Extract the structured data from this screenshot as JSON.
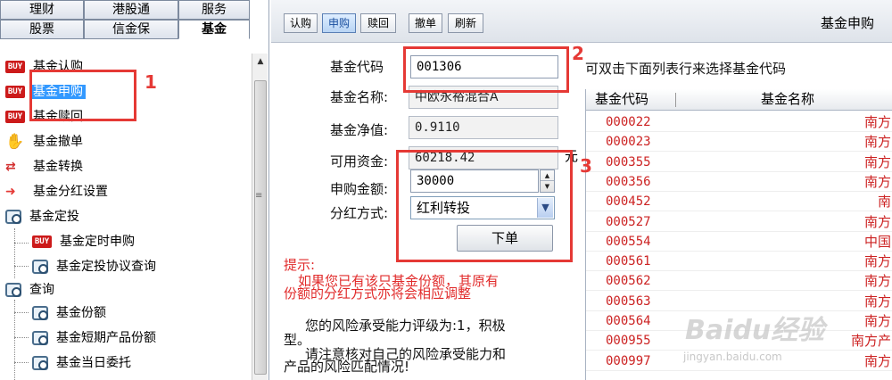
{
  "left_tabs": {
    "row1": [
      "理财",
      "港股通",
      "服务"
    ],
    "row2": [
      "股票",
      "信金保",
      "基金"
    ],
    "active": "基金"
  },
  "tree": [
    {
      "label": "基金认购",
      "icon": "buy-icon"
    },
    {
      "label": "基金申购",
      "icon": "buy-icon",
      "selected": true
    },
    {
      "label": "基金赎回",
      "icon": "buy-icon"
    },
    {
      "label": "基金撤单",
      "icon": "hand-icon"
    },
    {
      "label": "基金转换",
      "icon": "swap-icon"
    },
    {
      "label": "基金分红设置",
      "icon": "arrow-right-icon"
    },
    {
      "label": "基金定投",
      "icon": "search-doc-icon"
    },
    {
      "label": "基金定时申购",
      "icon": "buy-icon"
    },
    {
      "label": "基金定投协议查询",
      "icon": "search-doc-icon"
    },
    {
      "label": "查询",
      "icon": "search-doc-icon"
    },
    {
      "label": "基金份额",
      "icon": "search-doc-icon"
    },
    {
      "label": "基金短期产品份额",
      "icon": "search-doc-icon"
    },
    {
      "label": "基金当日委托",
      "icon": "search-doc-icon"
    }
  ],
  "buy_badge": "BUY",
  "toolbar": {
    "buttons": [
      "认购",
      "申购",
      "赎回",
      "撤单",
      "刷新"
    ],
    "active": "申购",
    "title": "基金申购"
  },
  "form": {
    "fund_code_label": "基金代码",
    "fund_code_value": "001306",
    "fund_name_label": "基金名称:",
    "fund_name_value": "中欧永裕混合A",
    "nav_label": "基金净值:",
    "nav_value": "0.9110",
    "funds_label": "可用资金:",
    "funds_value": "60218.42",
    "funds_unit": "元",
    "amount_label": "申购金额:",
    "amount_value": "30000",
    "dividend_label": "分红方式:",
    "dividend_value": "红利转投",
    "order_button": "下单"
  },
  "hint": {
    "title": "提示:",
    "line1": "如果您已有该只基金份额，其原有",
    "line2": "份额的分红方式亦将会相应调整"
  },
  "risk_note": {
    "line1": "您的风险承受能力评级为:1，积极",
    "line2": "型。",
    "line3": "请注意核对自己的风险承受能力和",
    "line4": "产品的风险匹配情况!"
  },
  "instruction": "可双击下面列表行来选择基金代码",
  "table": {
    "headers": [
      "基金代码",
      "基金名称"
    ],
    "rows": [
      {
        "code": "000022",
        "name": "南方"
      },
      {
        "code": "000023",
        "name": "南方"
      },
      {
        "code": "000355",
        "name": "南方"
      },
      {
        "code": "000356",
        "name": "南方"
      },
      {
        "code": "000452",
        "name": "南"
      },
      {
        "code": "000527",
        "name": "南方"
      },
      {
        "code": "000554",
        "name": "中国"
      },
      {
        "code": "000561",
        "name": "南方"
      },
      {
        "code": "000562",
        "name": "南方"
      },
      {
        "code": "000563",
        "name": "南方"
      },
      {
        "code": "000564",
        "name": "南方"
      },
      {
        "code": "000955",
        "name": "南方产"
      },
      {
        "code": "000997",
        "name": "南方"
      }
    ]
  },
  "annotations": [
    "1",
    "2",
    "3"
  ],
  "watermark": {
    "brand": "Baidu经验",
    "url": "jingyan.baidu.com"
  },
  "colors": {
    "accent_red": "#e53935",
    "select_blue": "#3399ff",
    "row_red": "#cc2222"
  }
}
